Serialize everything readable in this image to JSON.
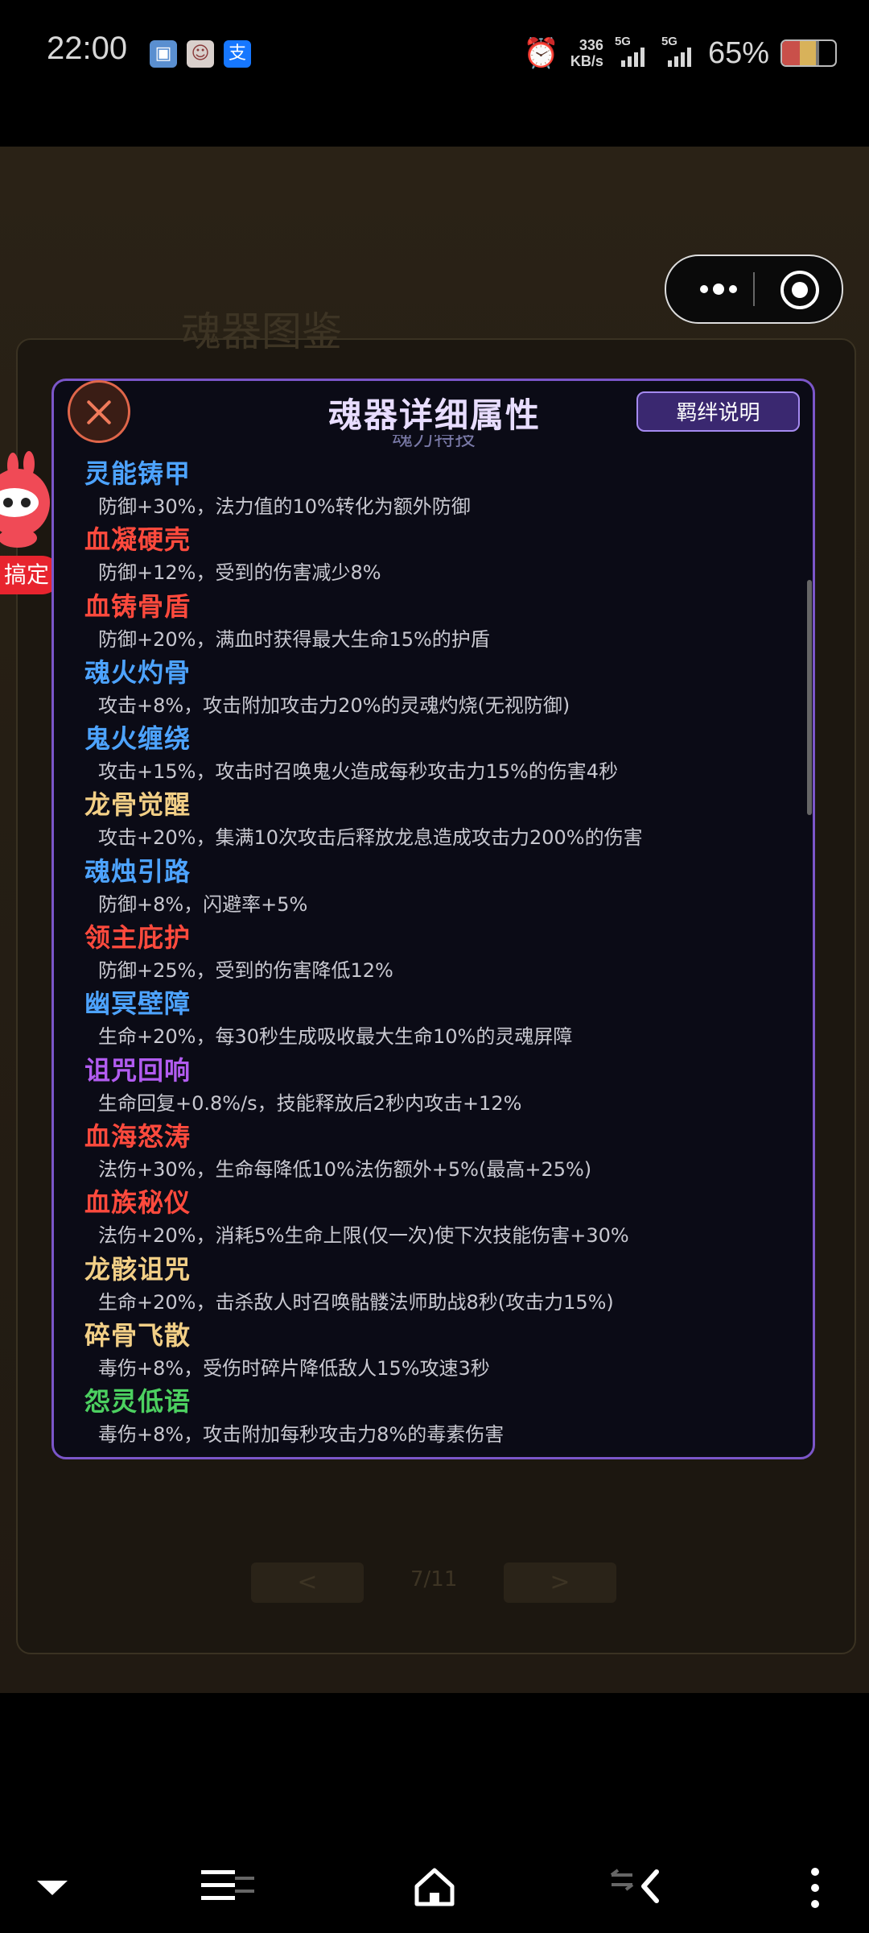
{
  "status_bar": {
    "time": "22:00",
    "net_speed_value": "336",
    "net_speed_unit": "KB/s",
    "sim1_label": "5G",
    "sim2_label": "5G",
    "battery_percent": "65%",
    "icons": [
      "gallery-app-icon",
      "avatar-app-icon",
      "alipay-app-icon",
      "alarm-icon"
    ]
  },
  "background": {
    "title": "魂器图鉴",
    "page_indicator": "7/11",
    "prev_label": "<",
    "next_label": ">"
  },
  "floating_widget": {
    "badge_label": "搞定"
  },
  "modal": {
    "title": "魂器详细属性",
    "bond_button_label": "羁绊说明",
    "partial_subtitle": "魂力特技",
    "items": [
      {
        "name": "灵能铸甲",
        "desc": "防御+30%，法力值的10%转化为额外防御",
        "color": "#4da3ff"
      },
      {
        "name": "血凝硬壳",
        "desc": "防御+12%，受到的伤害减少8%",
        "color": "#ff4a3d"
      },
      {
        "name": "血铸骨盾",
        "desc": "防御+20%，满血时获得最大生命15%的护盾",
        "color": "#ff4a3d"
      },
      {
        "name": "魂火灼骨",
        "desc": "攻击+8%，攻击附加攻击力20%的灵魂灼烧(无视防御)",
        "color": "#4da3ff"
      },
      {
        "name": "鬼火缠绕",
        "desc": "攻击+15%，攻击时召唤鬼火造成每秒攻击力15%的伤害4秒",
        "color": "#4da3ff"
      },
      {
        "name": "龙骨觉醒",
        "desc": "攻击+20%，集满10次攻击后释放龙息造成攻击力200%的伤害",
        "color": "#f2cf86"
      },
      {
        "name": "魂烛引路",
        "desc": "防御+8%，闪避率+5%",
        "color": "#4da3ff"
      },
      {
        "name": "领主庇护",
        "desc": "防御+25%，受到的伤害降低12%",
        "color": "#ff4a3d"
      },
      {
        "name": "幽冥壁障",
        "desc": "生命+20%，每30秒生成吸收最大生命10%的灵魂屏障",
        "color": "#4da3ff"
      },
      {
        "name": "诅咒回响",
        "desc": "生命回复+0.8%/s，技能释放后2秒内攻击+12%",
        "color": "#b25cf0"
      },
      {
        "name": "血海怒涛",
        "desc": "法伤+30%，生命每降低10%法伤额外+5%(最高+25%)",
        "color": "#ff4a3d"
      },
      {
        "name": "血族秘仪",
        "desc": "法伤+20%，消耗5%生命上限(仅一次)使下次技能伤害+30%",
        "color": "#ff4a3d"
      },
      {
        "name": "龙骸诅咒",
        "desc": "生命+20%，击杀敌人时召唤骷髅法师助战8秒(攻击力15%)",
        "color": "#f2cf86"
      },
      {
        "name": "碎骨飞散",
        "desc": "毒伤+8%，受伤时碎片降低敌人15%攻速3秒",
        "color": "#f2cf86"
      },
      {
        "name": "怨灵低语",
        "desc": "毒伤+8%，攻击附加每秒攻击力8%的毒素伤害",
        "color": "#4cd060"
      }
    ]
  },
  "nav_bar": {
    "icons": [
      "chevron-down-icon",
      "menu-icon",
      "home-icon",
      "back-icon",
      "more-vertical-icon"
    ]
  }
}
